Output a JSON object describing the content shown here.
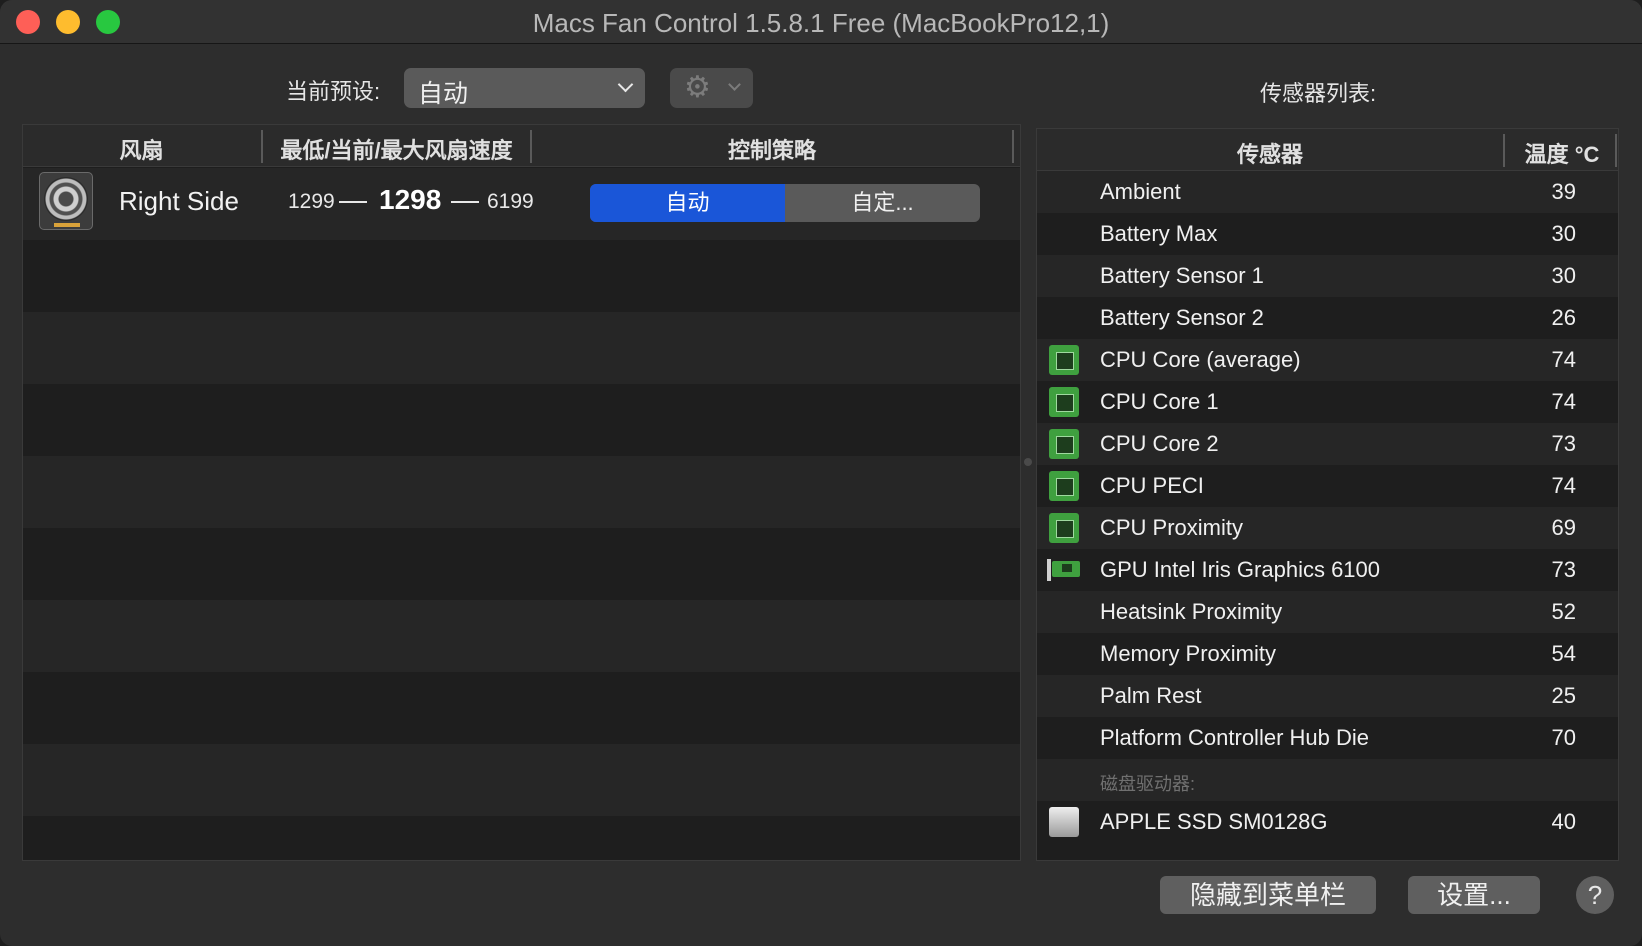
{
  "window": {
    "title": "Macs Fan Control 1.5.8.1 Free (MacBookPro12,1)"
  },
  "preset": {
    "label": "当前预设:",
    "selected": "自动"
  },
  "gear": {
    "glyph": "⚙"
  },
  "sensor_list_label": "传感器列表:",
  "fan_table": {
    "columns": [
      "风扇",
      "最低/当前/最大风扇速度",
      "控制策略"
    ],
    "fans": [
      {
        "name": "Right Side",
        "min_speed": "1299",
        "current_speed": "1298",
        "max_speed": "6199",
        "control_auto_label": "自动",
        "control_custom_label": "自定...",
        "selected_control": "自动"
      }
    ]
  },
  "sensor_table": {
    "columns": [
      "传感器",
      "温度 °C"
    ],
    "rows": [
      {
        "name": "Ambient",
        "temp": "39",
        "icon": ""
      },
      {
        "name": "Battery Max",
        "temp": "30",
        "icon": ""
      },
      {
        "name": "Battery Sensor 1",
        "temp": "30",
        "icon": ""
      },
      {
        "name": "Battery Sensor 2",
        "temp": "26",
        "icon": ""
      },
      {
        "name": "CPU Core (average)",
        "temp": "74",
        "icon": "cpu-chip-icon"
      },
      {
        "name": "CPU Core 1",
        "temp": "74",
        "icon": "cpu-chip-icon"
      },
      {
        "name": "CPU Core 2",
        "temp": "73",
        "icon": "cpu-chip-icon"
      },
      {
        "name": "CPU PECI",
        "temp": "74",
        "icon": "cpu-chip-icon"
      },
      {
        "name": "CPU Proximity",
        "temp": "69",
        "icon": "cpu-chip-icon"
      },
      {
        "name": "GPU Intel Iris Graphics 6100",
        "temp": "73",
        "icon": "gpu-card-icon"
      },
      {
        "name": "Heatsink Proximity",
        "temp": "52",
        "icon": ""
      },
      {
        "name": "Memory Proximity",
        "temp": "54",
        "icon": ""
      },
      {
        "name": "Palm Rest",
        "temp": "25",
        "icon": ""
      },
      {
        "name": "Platform Controller Hub Die",
        "temp": "70",
        "icon": ""
      }
    ],
    "disk_group_label": "磁盘驱动器:",
    "disks": [
      {
        "name": "APPLE SSD SM0128G",
        "temp": "40",
        "icon": "ssd-drive-icon"
      }
    ]
  },
  "buttons": {
    "hide_to_menubar": "隐藏到菜单栏",
    "settings": "设置...",
    "help": "?"
  },
  "colors": {
    "accent": "#1a56d8",
    "close": "#fe5f57",
    "minimize": "#febc2e",
    "maximize": "#28c840"
  }
}
